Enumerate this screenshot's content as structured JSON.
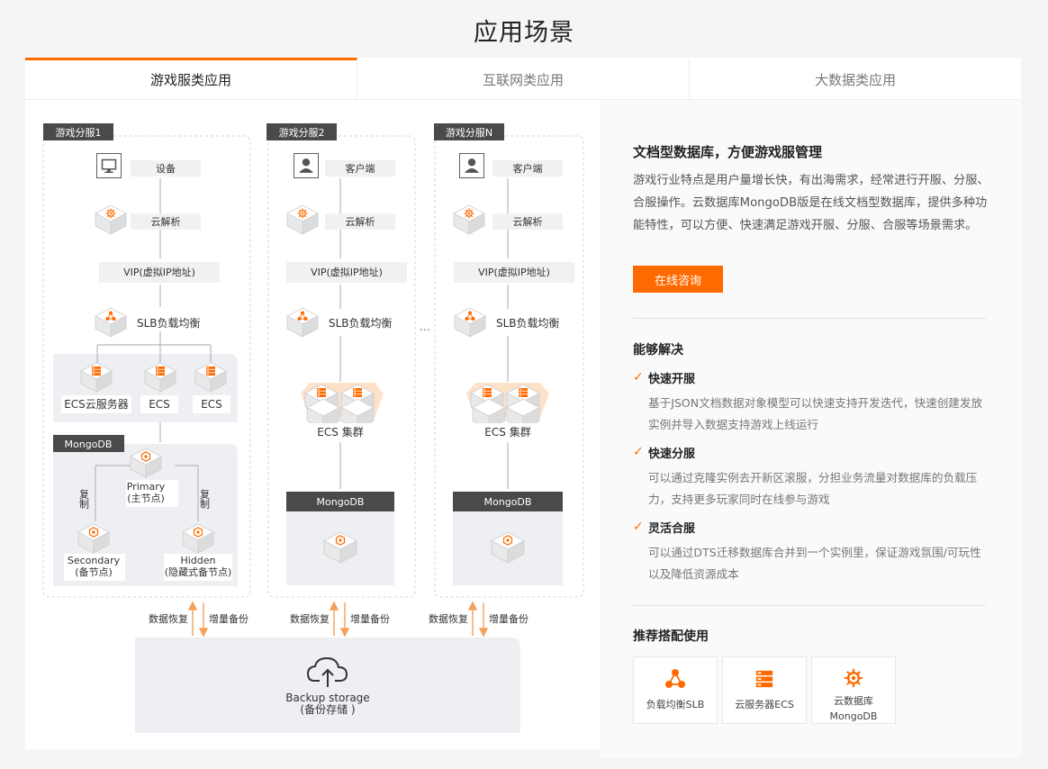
{
  "page": {
    "title": "应用场景"
  },
  "tabs": [
    {
      "label": "游戏服类应用",
      "active": true
    },
    {
      "label": "互联网类应用",
      "active": false
    },
    {
      "label": "大数据类应用",
      "active": false
    }
  ],
  "diagram": {
    "clusters": [
      {
        "tag": "游戏分服1",
        "device": "设备",
        "dns": "云解析",
        "vip": "VIP(虚拟IP地址)",
        "slb": "SLB负载均衡",
        "ecs": [
          "ECS云服务器",
          "ECS",
          "ECS"
        ],
        "mongodb": "MongoDB",
        "primary": [
          "Primary",
          "(主节点)"
        ],
        "secondary": [
          "Secondary",
          "(备节点)"
        ],
        "hidden": [
          "Hidden",
          "(隐藏式备节点)"
        ],
        "replicate": "复制"
      },
      {
        "tag": "游戏分服2",
        "device": "客户端",
        "dns": "云解析",
        "vip": "VIP(虚拟IP地址)",
        "slb": "SLB负载均衡",
        "ecs_cluster": "ECS 集群",
        "mongodb": "MongoDB"
      },
      {
        "tag": "游戏分服N",
        "device": "客户端",
        "dns": "云解析",
        "vip": "VIP(虚拟IP地址)",
        "slb": "SLB负载均衡",
        "ecs_cluster": "ECS 集群",
        "mongodb": "MongoDB"
      }
    ],
    "ellipsis": "···",
    "restore_label": "数据恢复",
    "backup_label": "增量备份",
    "storage": [
      "Backup storage",
      "(备份存储 )"
    ]
  },
  "info": {
    "title": "文档型数据库，方便游戏服管理",
    "description": "游戏行业特点是用户量增长快，有出海需求，经常进行开服、分服、合服操作。云数据库MongoDB版是在线文档型数据库，提供多种功能特性，可以方便、快速满足游戏开服、分服、合服等场景需求。",
    "consult_button": "在线咨询",
    "solve_title": "能够解决",
    "features": [
      {
        "title": "快速开服",
        "desc": "基于JSON文档数据对象模型可以快速支持开发迭代，快速创建发放实例并导入数据支持游戏上线运行"
      },
      {
        "title": "快速分服",
        "desc": "可以通过克隆实例去开新区滚服，分担业务流量对数据库的负载压力，支持更多玩家同时在线参与游戏"
      },
      {
        "title": "灵活合服",
        "desc": "可以通过DTS迁移数据库合并到一个实例里，保证游戏氛围/可玩性以及降低资源成本"
      }
    ],
    "recommend_title": "推荐搭配使用",
    "products": [
      {
        "label": "负载均衡SLB",
        "icon": "slb-icon"
      },
      {
        "label": "云服务器ECS",
        "icon": "ecs-server-icon"
      },
      {
        "label": "云数据库MongoDB",
        "icon": "mongodb-icon"
      }
    ]
  },
  "colors": {
    "accent": "#ff6a00",
    "dark_tag": "#4a4a4a",
    "band": "#eeeff3"
  }
}
